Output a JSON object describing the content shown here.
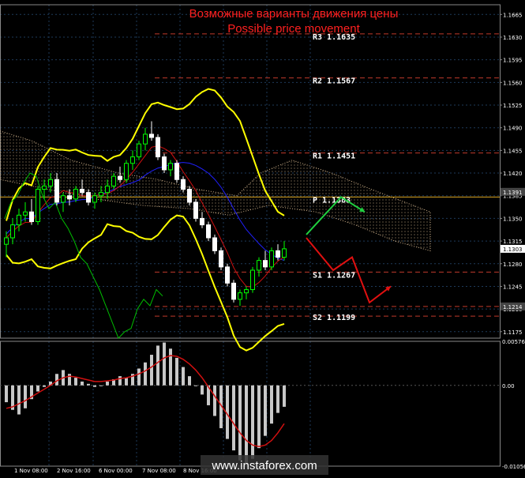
{
  "title_ru": "Возможные варианты движения цены",
  "title_en": "Possible price movement",
  "watermark": "www.instaforex.com",
  "colors": {
    "background": "#000000",
    "grid": "#1e3a5a",
    "level_line": "#c0392b",
    "pivot_line": "#d9a521",
    "title": "#ff2020",
    "bollinger": "#ffff00",
    "histogram": "#c8c8c8",
    "signal": "#d01010",
    "ichimoku_cloud": "#d2b48c",
    "tenkan": "#d01010",
    "kijun": "#2020ff",
    "chikou": "#00c000",
    "bull_candle": "#00ff00",
    "bear_candle": "#ffffff",
    "arrow_up": "#20d040",
    "arrow_down": "#e01010"
  },
  "chart_data": {
    "type": "candlestick",
    "price_axis": {
      "ylim": [
        1.1165,
        1.168
      ],
      "ticks": [
        "1.1665",
        "1.1630",
        "1.1595",
        "1.1560",
        "1.1525",
        "1.1490",
        "1.1455",
        "1.1420",
        "1.1385",
        "1.1350",
        "1.1315",
        "1.1280",
        "1.1245",
        "1.1210",
        "1.1175"
      ],
      "highlighted_labels": [
        {
          "text": "1.1391",
          "value": 1.1391,
          "color": "#444444"
        },
        {
          "text": "1.1303",
          "value": 1.1303,
          "color": "#ffffff"
        },
        {
          "text": "1.1214",
          "value": 1.1214,
          "color": "#444444"
        }
      ]
    },
    "time_axis": [
      "1 Nov 08:00",
      "2 Nov 16:00",
      "6 Nov 00:00",
      "7 Nov 08:00",
      "8 Nov 16:00"
    ],
    "levels": [
      {
        "name": "R3",
        "label": "R3  1.1635",
        "value": 1.1635
      },
      {
        "name": "R2",
        "label": "R2  1.1567",
        "value": 1.1567
      },
      {
        "name": "R1",
        "label": "R1  1.1451",
        "value": 1.1451
      },
      {
        "name": "P",
        "label": "P  1.1383",
        "value": 1.1383
      },
      {
        "name": "S1",
        "label": "S1  1.1267",
        "value": 1.1267
      },
      {
        "name": "S2",
        "label": "S2  1.1199",
        "value": 1.1199
      }
    ],
    "candles": [
      [
        1.131,
        1.133,
        1.129,
        1.132
      ],
      [
        1.132,
        1.135,
        1.131,
        1.134
      ],
      [
        1.134,
        1.1365,
        1.133,
        1.1355
      ],
      [
        1.1355,
        1.1375,
        1.1345,
        1.136
      ],
      [
        1.136,
        1.138,
        1.134,
        1.1345
      ],
      [
        1.1345,
        1.14,
        1.134,
        1.1395
      ],
      [
        1.1395,
        1.141,
        1.138,
        1.14
      ],
      [
        1.14,
        1.142,
        1.139,
        1.141
      ],
      [
        1.141,
        1.142,
        1.137,
        1.1375
      ],
      [
        1.1375,
        1.139,
        1.136,
        1.1385
      ],
      [
        1.1385,
        1.1395,
        1.137,
        1.138
      ],
      [
        1.138,
        1.14,
        1.1375,
        1.1395
      ],
      [
        1.1395,
        1.141,
        1.1385,
        1.139
      ],
      [
        1.139,
        1.1395,
        1.137,
        1.1375
      ],
      [
        1.1375,
        1.139,
        1.1365,
        1.1385
      ],
      [
        1.1385,
        1.14,
        1.1375,
        1.139
      ],
      [
        1.139,
        1.141,
        1.138,
        1.14
      ],
      [
        1.14,
        1.142,
        1.1395,
        1.1415
      ],
      [
        1.1415,
        1.143,
        1.1405,
        1.141
      ],
      [
        1.141,
        1.144,
        1.1405,
        1.1435
      ],
      [
        1.1435,
        1.1455,
        1.1425,
        1.1445
      ],
      [
        1.1445,
        1.147,
        1.144,
        1.1465
      ],
      [
        1.1465,
        1.149,
        1.1455,
        1.148
      ],
      [
        1.148,
        1.15,
        1.147,
        1.1475
      ],
      [
        1.1475,
        1.148,
        1.144,
        1.1445
      ],
      [
        1.1445,
        1.145,
        1.142,
        1.1425
      ],
      [
        1.1425,
        1.144,
        1.1415,
        1.1435
      ],
      [
        1.1435,
        1.144,
        1.1405,
        1.141
      ],
      [
        1.141,
        1.1415,
        1.139,
        1.1395
      ],
      [
        1.1395,
        1.14,
        1.137,
        1.1375
      ],
      [
        1.1375,
        1.138,
        1.1345,
        1.135
      ],
      [
        1.135,
        1.136,
        1.1335,
        1.134
      ],
      [
        1.134,
        1.1345,
        1.1315,
        1.132
      ],
      [
        1.132,
        1.1325,
        1.1295,
        1.13
      ],
      [
        1.13,
        1.1305,
        1.127,
        1.1275
      ],
      [
        1.1275,
        1.128,
        1.1245,
        1.125
      ],
      [
        1.125,
        1.1255,
        1.122,
        1.1225
      ],
      [
        1.1225,
        1.124,
        1.1215,
        1.1235
      ],
      [
        1.1235,
        1.1245,
        1.1225,
        1.124
      ],
      [
        1.124,
        1.1275,
        1.1235,
        1.127
      ],
      [
        1.127,
        1.129,
        1.126,
        1.1285
      ],
      [
        1.1285,
        1.13,
        1.127,
        1.1275
      ],
      [
        1.1275,
        1.1305,
        1.127,
        1.13
      ],
      [
        1.13,
        1.131,
        1.1285,
        1.129
      ],
      [
        1.129,
        1.1315,
        1.1285,
        1.1303
      ]
    ],
    "forecast": {
      "up": [
        [
          1.1325,
          1.1383
        ],
        [
          1.1383,
          1.136
        ]
      ],
      "down": [
        [
          1.132,
          1.127
        ],
        [
          1.127,
          1.129
        ],
        [
          1.129,
          1.122
        ],
        [
          1.122,
          1.1245
        ]
      ]
    },
    "oscillator": {
      "ticks": [
        "0.00576",
        "0.00",
        "-0.01056"
      ],
      "ylim": [
        -0.01056,
        0.00576
      ],
      "histogram": [
        -0.0022,
        -0.0032,
        -0.0038,
        -0.003,
        -0.0018,
        -0.0008,
        -0.0002,
        0.0005,
        0.0015,
        0.002,
        0.0015,
        0.001,
        0.0005,
        0.0002,
        -0.0002,
        0.0,
        0.0005,
        0.0008,
        0.0012,
        0.001,
        0.0015,
        0.0022,
        0.003,
        0.004,
        0.0052,
        0.0056,
        0.0048,
        0.0036,
        0.0024,
        0.0012,
        0.0,
        -0.0012,
        -0.0026,
        -0.004,
        -0.0056,
        -0.007,
        -0.0085,
        -0.0098,
        -0.0104,
        -0.0096,
        -0.0082,
        -0.0066,
        -0.005,
        -0.0036,
        -0.0028
      ],
      "signal": [
        -0.003,
        -0.0028,
        -0.0024,
        -0.002,
        -0.0015,
        -0.001,
        -0.0005,
        0.0,
        0.0006,
        0.001,
        0.0012,
        0.0011,
        0.0009,
        0.0007,
        0.0005,
        0.0005,
        0.0006,
        0.0007,
        0.0009,
        0.001,
        0.0012,
        0.0015,
        0.0019,
        0.0024,
        0.003,
        0.0036,
        0.0039,
        0.0038,
        0.0034,
        0.0028,
        0.002,
        0.001,
        -0.0002,
        -0.0014,
        -0.0026,
        -0.0038,
        -0.005,
        -0.0062,
        -0.0072,
        -0.0078,
        -0.008,
        -0.0078,
        -0.0072,
        -0.0062,
        -0.005
      ]
    }
  }
}
